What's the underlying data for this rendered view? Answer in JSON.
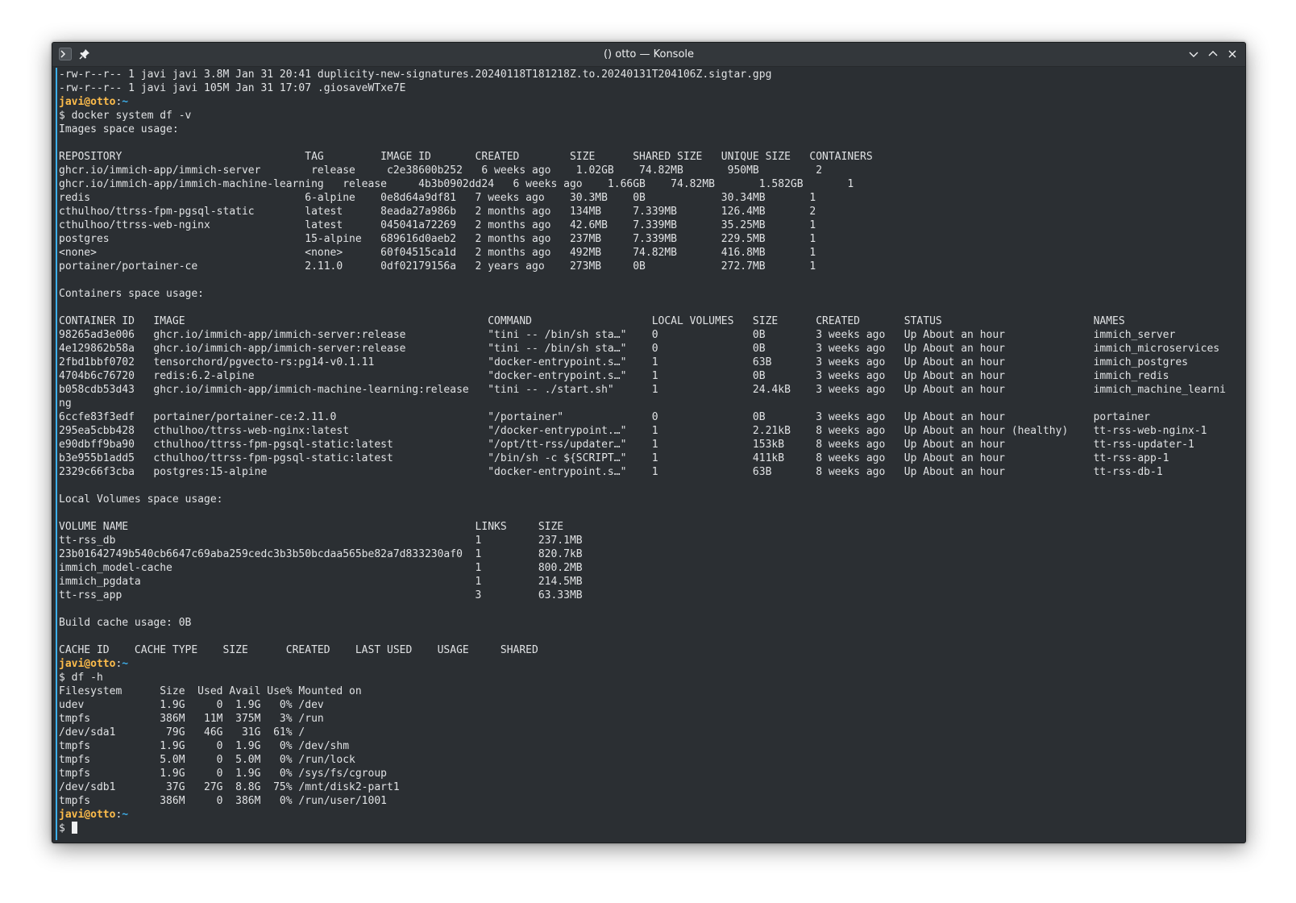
{
  "window": {
    "title": "() otto — Konsole",
    "icons": {
      "app": "terminal-prompt-icon",
      "pin": "pin-icon",
      "minimize": "chevron-down-icon",
      "maximize": "chevron-up-icon",
      "close": "close-icon"
    }
  },
  "colors": {
    "background": "#2b2f33",
    "text": "#e0e2e4",
    "prompt_user": "#fdbc4b",
    "prompt_path": "#3daee9",
    "accent": "#3daee9"
  },
  "prompt": {
    "user_host": "javi@otto",
    "path": "~",
    "symbol": "$"
  },
  "commands": {
    "docker_df": "docker system df -v",
    "df_h": "df -h"
  },
  "output": {
    "ls_lines": [
      "-rw-r--r-- 1 javi javi 3.8M Jan 31 20:41 duplicity-new-signatures.20240118T181218Z.to.20240131T204106Z.sigtar.gpg",
      "-rw-r--r-- 1 javi javi 105M Jan 31 17:07 .giosaveWTxe7E"
    ],
    "images": {
      "heading": "Images space usage:",
      "header": "REPOSITORY                             TAG         IMAGE ID       CREATED        SIZE      SHARED SIZE   UNIQUE SIZE   CONTAINERS",
      "rows": [
        "ghcr.io/immich-app/immich-server        release     c2e38600b252   6 weeks ago    1.02GB    74.82MB       950MB         2",
        "ghcr.io/immich-app/immich-machine-learning   release     4b3b0902dd24   6 weeks ago    1.66GB    74.82MB       1.582GB       1",
        "redis                                  6-alpine    0e8d64a9df81   7 weeks ago    30.3MB    0B            30.34MB       1",
        "cthulhoo/ttrss-fpm-pgsql-static        latest      8eada27a986b   2 months ago   134MB     7.339MB       126.4MB       2",
        "cthulhoo/ttrss-web-nginx               latest      045041a72269   2 months ago   42.6MB    7.339MB       35.25MB       1",
        "postgres                               15-alpine   689616d0aeb2   2 months ago   237MB     7.339MB       229.5MB       1",
        "<none>                                 <none>      60f04515ca1d   2 months ago   492MB     74.82MB       416.8MB       1",
        "portainer/portainer-ce                 2.11.0      0df02179156a   2 years ago    273MB     0B            272.7MB       1"
      ]
    },
    "containers": {
      "heading": "Containers space usage:",
      "header": "CONTAINER ID   IMAGE                                                COMMAND                   LOCAL VOLUMES   SIZE      CREATED       STATUS                        NAMES",
      "rows": [
        "98265ad3e006   ghcr.io/immich-app/immich-server:release             \"tini -- /bin/sh sta…\"    0               0B        3 weeks ago   Up About an hour              immich_server",
        "4e129862b58a   ghcr.io/immich-app/immich-server:release             \"tini -- /bin/sh sta…\"    0               0B        3 weeks ago   Up About an hour              immich_microservices",
        "2fbd1bbf0702   tensorchord/pgvecto-rs:pg14-v0.1.11                  \"docker-entrypoint.s…\"    1               63B       3 weeks ago   Up About an hour              immich_postgres",
        "4704b6c76720   redis:6.2-alpine                                     \"docker-entrypoint.s…\"    1               0B        3 weeks ago   Up About an hour              immich_redis",
        "b058cdb53d43   ghcr.io/immich-app/immich-machine-learning:release   \"tini -- ./start.sh\"      1               24.4kB    3 weeks ago   Up About an hour              immich_machine_learni",
        "ng",
        "6ccfe83f3edf   portainer/portainer-ce:2.11.0                        \"/portainer\"              0               0B        3 weeks ago   Up About an hour              portainer",
        "295ea5cbb428   cthulhoo/ttrss-web-nginx:latest                      \"/docker-entrypoint.…\"    1               2.21kB    8 weeks ago   Up About an hour (healthy)    tt-rss-web-nginx-1",
        "e90dbff9ba90   cthulhoo/ttrss-fpm-pgsql-static:latest               \"/opt/tt-rss/updater…\"    1               153kB     8 weeks ago   Up About an hour              tt-rss-updater-1",
        "b3e955b1add5   cthulhoo/ttrss-fpm-pgsql-static:latest               \"/bin/sh -c ${SCRIPT…\"    1               411kB     8 weeks ago   Up About an hour              tt-rss-app-1",
        "2329c66f3cba   postgres:15-alpine                                   \"docker-entrypoint.s…\"    1               63B       8 weeks ago   Up About an hour              tt-rss-db-1"
      ]
    },
    "volumes": {
      "heading": "Local Volumes space usage:",
      "header": "VOLUME NAME                                                       LINKS     SIZE",
      "rows": [
        "tt-rss_db                                                         1         237.1MB",
        "23b01642749b540cb6647c69aba259cedc3b3b50bcdaa565be82a7d833230af0  1         820.7kB",
        "immich_model-cache                                                1         800.2MB",
        "immich_pgdata                                                     1         214.5MB",
        "tt-rss_app                                                        3         63.33MB"
      ]
    },
    "build_cache": {
      "heading": "Build cache usage: 0B",
      "header": "CACHE ID    CACHE TYPE    SIZE      CREATED    LAST USED    USAGE     SHARED"
    },
    "df": {
      "header": "Filesystem      Size  Used Avail Use% Mounted on",
      "rows": [
        "udev            1.9G     0  1.9G   0% /dev",
        "tmpfs           386M   11M  375M   3% /run",
        "/dev/sda1        79G   46G   31G  61% /",
        "tmpfs           1.9G     0  1.9G   0% /dev/shm",
        "tmpfs           5.0M     0  5.0M   0% /run/lock",
        "tmpfs           1.9G     0  1.9G   0% /sys/fs/cgroup",
        "/dev/sdb1        37G   27G  8.8G  75% /mnt/disk2-part1",
        "tmpfs           386M     0  386M   0% /run/user/1001"
      ]
    }
  }
}
